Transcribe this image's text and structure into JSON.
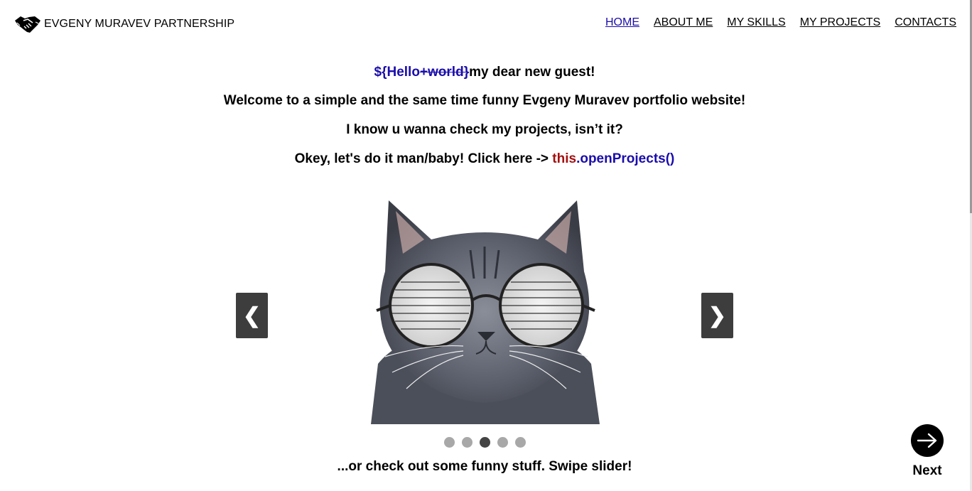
{
  "header": {
    "logo_text": "EVGENY MURAVEV PARTNERSHIP",
    "logo_icon": "handshake-icon",
    "nav": [
      {
        "label": "HOME",
        "active": true
      },
      {
        "label": "ABOUT ME",
        "active": false
      },
      {
        "label": "MY SKILLS",
        "active": false
      },
      {
        "label": "MY PROJECTS",
        "active": false
      },
      {
        "label": "CONTACTS",
        "active": false
      }
    ]
  },
  "intro": {
    "line1_code_prefix": "${Hello",
    "line1_code_strike": "+world}",
    "line1_text": "my dear new guest!",
    "line2": "Welcome to a simple and the same time funny Evgeny Muravev portfolio website!",
    "line3": "I know u wanna check my projects, isn’t it?",
    "line4_text": "Okey, let's do it man/baby! Click here -> ",
    "line4_code_this": "this",
    "line4_code_dot": ".",
    "line4_code_call": "openProjects()"
  },
  "slider": {
    "prev_icon": "chevron-left-icon",
    "next_icon": "chevron-right-icon",
    "prev_glyph": "❮",
    "next_glyph": "❯",
    "image": "cat-with-glasses",
    "slide_count": 5,
    "active_index": 2
  },
  "footer_text": "...or check out some funny stuff. Swipe slider!",
  "next_button": {
    "label": "Next",
    "icon": "arrow-right-icon"
  },
  "colors": {
    "code_blue": "#1a0dab",
    "code_red": "#a50e0e",
    "arrow_bg": "#3d3d3d"
  }
}
